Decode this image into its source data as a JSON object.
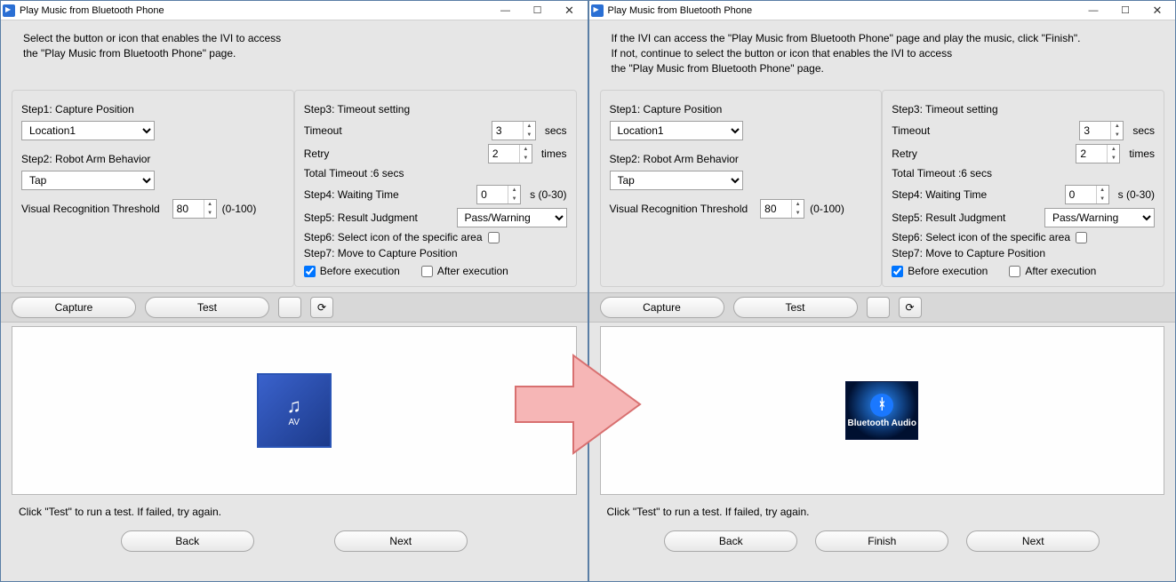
{
  "windows": [
    {
      "title": "Play Music from Bluetooth Phone",
      "instruction": "Select the button or icon that enables the IVI to access\nthe \"Play Music from Bluetooth Phone\" page.",
      "left": {
        "step1": "Step1: Capture Position",
        "location": "Location1",
        "step2": "Step2: Robot Arm Behavior",
        "behavior": "Tap",
        "vrt_label": "Visual Recognition Threshold",
        "vrt_value": "80",
        "vrt_range": "(0-100)"
      },
      "right": {
        "step3": "Step3: Timeout setting",
        "timeout_label": "Timeout",
        "timeout_value": "3",
        "timeout_unit": "secs",
        "retry_label": "Retry",
        "retry_value": "2",
        "retry_unit": "times",
        "total_timeout": "Total Timeout :6 secs",
        "step4": "Step4: Waiting Time",
        "wait_value": "0",
        "wait_unit": "s (0-30)",
        "step5": "Step5: Result Judgment",
        "judgment": "Pass/Warning",
        "step6": "Step6: Select icon of the specific area",
        "step7": "Step7: Move to Capture Position",
        "before": "Before execution",
        "after": "After execution"
      },
      "buttons": {
        "capture": "Capture",
        "test": "Test"
      },
      "thumb": {
        "icon": "♫",
        "label": "AV"
      },
      "hint": "Click \"Test\" to run a test. If failed, try again.",
      "footer": {
        "back": "Back",
        "next": "Next"
      }
    },
    {
      "title": "Play Music from Bluetooth Phone",
      "instruction": "If the IVI can access the \"Play Music from Bluetooth Phone\" page and play the music, click \"Finish\".\nIf not, continue to select the button or icon that enables the IVI to access\nthe \"Play Music from Bluetooth Phone\" page.",
      "left": {
        "step1": "Step1: Capture Position",
        "location": "Location1",
        "step2": "Step2: Robot Arm Behavior",
        "behavior": "Tap",
        "vrt_label": "Visual Recognition Threshold",
        "vrt_value": "80",
        "vrt_range": "(0-100)"
      },
      "right": {
        "step3": "Step3: Timeout setting",
        "timeout_label": "Timeout",
        "timeout_value": "3",
        "timeout_unit": "secs",
        "retry_label": "Retry",
        "retry_value": "2",
        "retry_unit": "times",
        "total_timeout": "Total Timeout :6 secs",
        "step4": "Step4: Waiting Time",
        "wait_value": "0",
        "wait_unit": "s (0-30)",
        "step5": "Step5: Result Judgment",
        "judgment": "Pass/Warning",
        "step6": "Step6: Select icon of the specific area",
        "step7": "Step7: Move to Capture Position",
        "before": "Before execution",
        "after": "After execution"
      },
      "buttons": {
        "capture": "Capture",
        "test": "Test"
      },
      "thumb": {
        "icon": "ᚼ",
        "label": "Bluetooth Audio"
      },
      "hint": "Click \"Test\" to run a test. If failed, try again.",
      "footer": {
        "back": "Back",
        "finish": "Finish",
        "next": "Next"
      }
    }
  ]
}
